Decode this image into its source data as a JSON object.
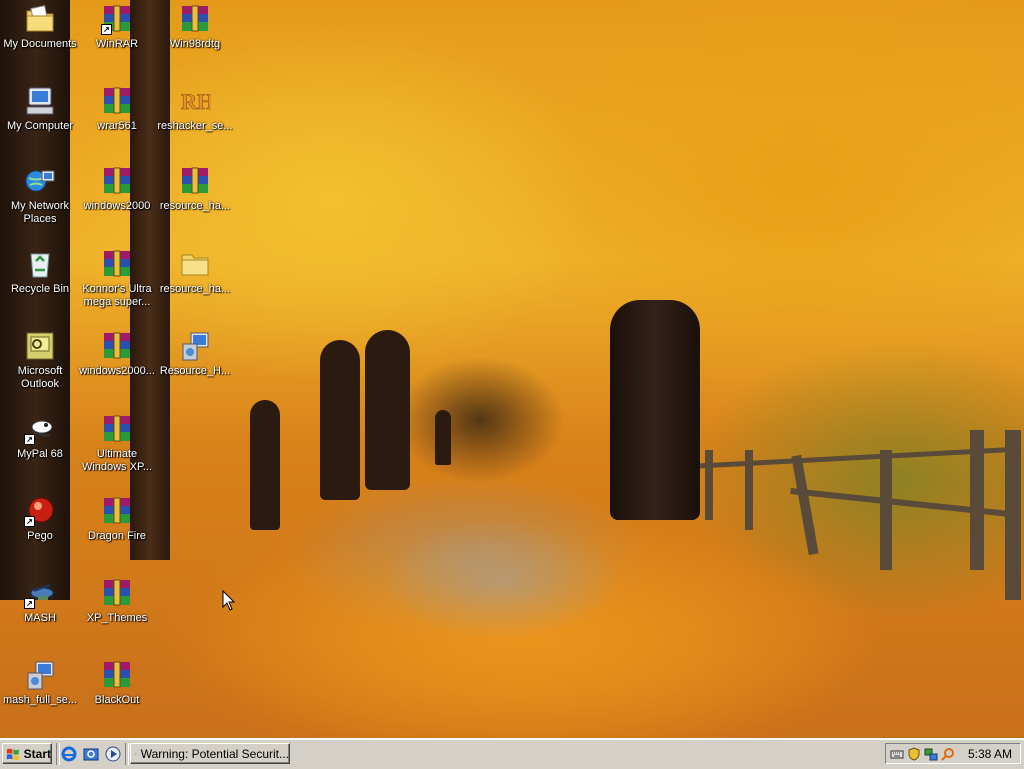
{
  "desktop": {
    "icons": [
      {
        "label": "My Documents",
        "icon": "folder-documents-icon"
      },
      {
        "label": "My Computer",
        "icon": "computer-icon"
      },
      {
        "label": "My Network Places",
        "icon": "network-icon"
      },
      {
        "label": "Recycle Bin",
        "icon": "recycle-bin-icon"
      },
      {
        "label": "Microsoft Outlook",
        "icon": "outlook-icon"
      },
      {
        "label": "MyPal 68",
        "icon": "mypal-icon"
      },
      {
        "label": "Pego",
        "icon": "pego-icon"
      },
      {
        "label": "MASH",
        "icon": "mash-icon"
      },
      {
        "label": "mash_full_se...",
        "icon": "installer-icon"
      },
      {
        "label": "WinRAR",
        "icon": "winrar-icon"
      },
      {
        "label": "wrar561",
        "icon": "winrar-archive-icon"
      },
      {
        "label": "windows2000",
        "icon": "winrar-archive-icon"
      },
      {
        "label": "Konnor's Ultra mega super...",
        "icon": "winrar-archive-icon"
      },
      {
        "label": "windows2000...",
        "icon": "winrar-archive-icon"
      },
      {
        "label": "Ultimate Windows XP...",
        "icon": "winrar-archive-icon"
      },
      {
        "label": "Dragon Fire",
        "icon": "winrar-archive-icon"
      },
      {
        "label": "XP_Themes",
        "icon": "winrar-archive-icon"
      },
      {
        "label": "BlackOut",
        "icon": "winrar-archive-icon"
      },
      {
        "label": "Win98rdtg",
        "icon": "winrar-archive-icon"
      },
      {
        "label": "reshacker_se...",
        "icon": "reshacker-icon"
      },
      {
        "label": "resource_ha...",
        "icon": "winrar-archive-icon"
      },
      {
        "label": "resource_ha...",
        "icon": "folder-icon"
      },
      {
        "label": "Resource_H...",
        "icon": "installer-icon"
      }
    ]
  },
  "taskbar": {
    "start_label": "Start",
    "quick_launch": [
      "internet-explorer-icon",
      "outlook-express-icon",
      "media-player-icon"
    ],
    "task_label": "Warning: Potential Securit...",
    "tray_icons": [
      "keyboard-icon",
      "security-shield-icon",
      "network-tray-icon",
      "search-tray-icon"
    ],
    "clock": "5:38 AM"
  },
  "colors": {
    "taskbar": "#d4d0c8",
    "winrar_red": "#b01818",
    "winrar_blue": "#2040a0"
  }
}
